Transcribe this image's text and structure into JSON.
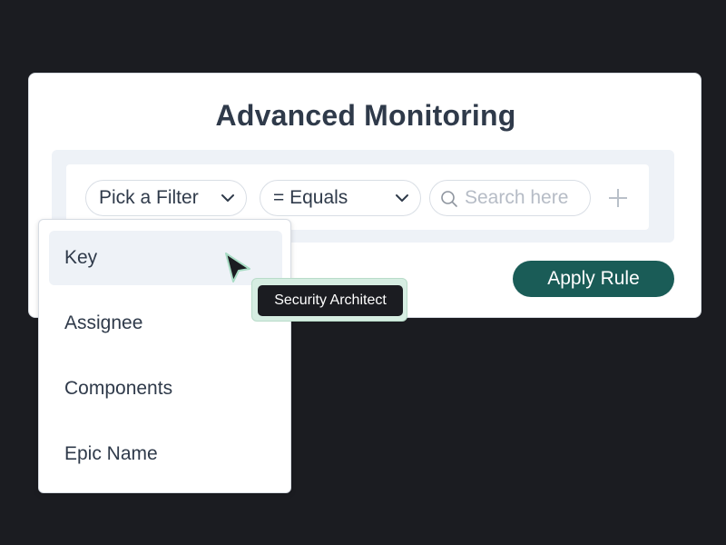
{
  "card": {
    "title": "Advanced Monitoring"
  },
  "filter_bar": {
    "field_select": {
      "value": "Pick a Filter",
      "icon": "chevron-down-icon"
    },
    "operator_select": {
      "value": "= Equals",
      "icon": "chevron-down-icon"
    },
    "search": {
      "placeholder": "Search here",
      "icon": "search-icon"
    },
    "add": {
      "icon": "plus-icon"
    }
  },
  "apply_button": {
    "label": "Apply Rule"
  },
  "dropdown": {
    "items": [
      {
        "label": "Key",
        "active": true
      },
      {
        "label": "Assignee",
        "active": false
      },
      {
        "label": "Components",
        "active": false
      },
      {
        "label": "Epic Name",
        "active": false
      }
    ]
  },
  "tooltip": {
    "label": "Security Architect"
  },
  "colors": {
    "background": "#1b1c21",
    "primary": "#1a5c57",
    "text": "#2f3a4a",
    "panel": "#eef2f7",
    "tooltip_glow": "#d6ede2"
  }
}
